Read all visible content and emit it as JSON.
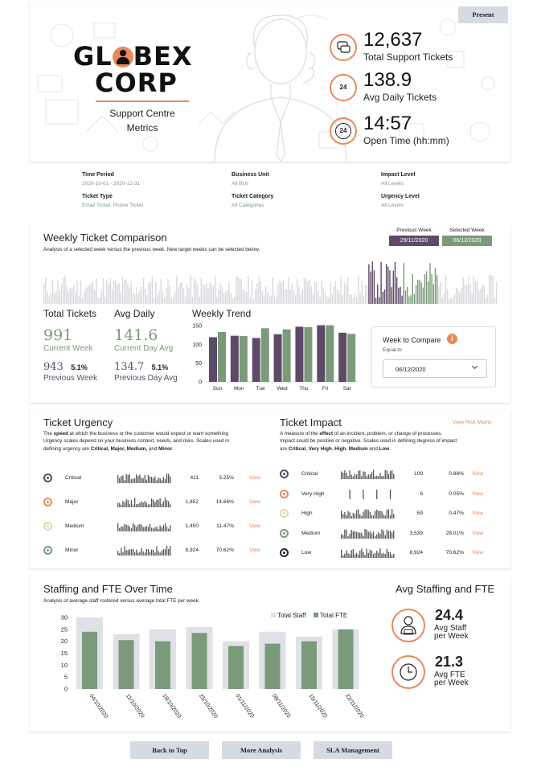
{
  "header": {
    "present_label": "Present",
    "logo_line1": "GL",
    "logo_line1b": "BEX",
    "logo_line2": "CORP",
    "subtitle_line1": "Support Centre",
    "subtitle_line2": "Metrics"
  },
  "kpis": [
    {
      "value": "12,637",
      "label": "Total Support Tickets",
      "icon": "chat-bubbles-icon"
    },
    {
      "value": "138.9",
      "label": "Avg Daily Tickets",
      "icon": "phone-24-icon"
    },
    {
      "value": "14:57",
      "label": "Open Time (hh:mm)",
      "icon": "clock-24-icon"
    }
  ],
  "filters": {
    "time_period": {
      "label": "Time Period",
      "value": "2020-10-01 - 2020-12-31"
    },
    "business_unit": {
      "label": "Business Unit",
      "value": "All BUs"
    },
    "impact_level": {
      "label": "Impact Level",
      "value": "All Levels"
    },
    "ticket_type": {
      "label": "Ticket Type",
      "value": "Email Ticket, Phone Ticket"
    },
    "ticket_category": {
      "label": "Ticket Category",
      "value": "All Categories"
    },
    "urgency_level": {
      "label": "Urgency Level",
      "value": "All Levels"
    }
  },
  "weekly": {
    "title": "Weekly Ticket Comparison",
    "description": "Analysis of a selected week versus the previous week. New target weeks can be selected below.",
    "previous_week_label": "Previous Week",
    "previous_week_value": "29/11/2020",
    "selected_week_label": "Selected Week",
    "selected_week_value": "06/12/2020",
    "total_tickets_title": "Total Tickets",
    "current_week_value": "991",
    "current_week_label": "Current Week",
    "previous_week_count": "943",
    "previous_week_pct": "5.1%",
    "previous_week_caption": "Previous Week",
    "avg_daily_title": "Avg Daily",
    "current_day_avg_value": "141.6",
    "current_day_avg_label": "Current Day Avg",
    "previous_day_avg_value": "134.7",
    "previous_day_avg_pct": "5.1%",
    "previous_day_avg_label": "Previous Day Avg",
    "trend_title": "Weekly Trend",
    "compare_title": "Week to Compare",
    "compare_equal_label": "Equal to",
    "compare_value": "06/12/2020"
  },
  "colors": {
    "purple": "#5e4a68",
    "green": "#7a9a7a",
    "orange": "#e8895a",
    "light_grey": "#e0e1e6"
  },
  "urgency": {
    "title": "Ticket Urgency",
    "desc_1": "The ",
    "desc_bold": "speed",
    "desc_2": " at which the business or the customer would expect or want something",
    "desc_line2": "Urgency scales depend on your business context, needs, and risks. Scales used in",
    "desc_line3a": "defining urgency are ",
    "desc_line3b": "Critical, Major, Medium,",
    "desc_line3c": " and ",
    "desc_line3d": "Minor",
    "desc_line3e": ".",
    "rows": [
      {
        "name": "Critical",
        "count": "411",
        "pct": "3.25%",
        "action": "View",
        "color": "#5e4a68"
      },
      {
        "name": "Major",
        "count": "1,852",
        "pct": "14.66%",
        "action": "View",
        "color": "#e8895a"
      },
      {
        "name": "Medium",
        "count": "1,450",
        "pct": "11.47%",
        "action": "View",
        "color": "#cfe3a8"
      },
      {
        "name": "Minor",
        "count": "8,924",
        "pct": "70.62%",
        "action": "View",
        "color": "#7a9a7a"
      }
    ]
  },
  "impact": {
    "title": "Ticket Impact",
    "link": "View Risk Matrix",
    "desc_1": "A measure of the ",
    "desc_bold": "effect",
    "desc_2": " of an incident, problem, or change of processes.",
    "desc_line2": "Impact could be positive or negative. Scales used in defining degress of impact",
    "desc_line3a": "are ",
    "desc_line3b": "Critical",
    "desc_line3c": ", ",
    "desc_line3d": "Very High",
    "desc_line3e": ", ",
    "desc_line3f": "High",
    "desc_line3g": ", ",
    "desc_line3h": "Medium",
    "desc_line3i": " and ",
    "desc_line3j": "Low",
    "desc_line3k": ".",
    "rows": [
      {
        "name": "Critical",
        "count": "109",
        "pct": "0.86%",
        "action": "View",
        "color": "#5e4a68"
      },
      {
        "name": "Very High",
        "count": "6",
        "pct": "0.05%",
        "action": "View",
        "color": "#e8895a"
      },
      {
        "name": "High",
        "count": "59",
        "pct": "0.47%",
        "action": "View",
        "color": "#cfe3a8"
      },
      {
        "name": "Medium",
        "count": "3,539",
        "pct": "28.01%",
        "action": "View",
        "color": "#7a9a7a"
      },
      {
        "name": "Low",
        "count": "8,924",
        "pct": "70.62%",
        "action": "View",
        "color": "#1f2a36"
      }
    ]
  },
  "staffing": {
    "title": "Staffing and FTE Over Time",
    "description": "Analysis of average staff rostered versus average total FTE per week.",
    "avg_title": "Avg Staffing and FTE",
    "avg_staff_value": "24.4",
    "avg_staff_label_1": "Avg Staff",
    "avg_staff_label_2": "per Week",
    "avg_fte_value": "21.3",
    "avg_fte_label_1": "Avg FTE",
    "avg_fte_label_2": "per Week"
  },
  "chart_data": [
    {
      "type": "bar",
      "name_hint": "weekly-trend",
      "title": "Weekly Trend",
      "categories": [
        "Sun",
        "Mon",
        "Tue",
        "Wed",
        "Thu",
        "Fri",
        "Sat"
      ],
      "series": [
        {
          "name": "Previous Week",
          "color": "#5e4a68",
          "values": [
            119,
            123,
            117,
            127,
            147,
            151,
            131
          ]
        },
        {
          "name": "Selected Week",
          "color": "#7a9a7a",
          "values": [
            133,
            122,
            143,
            140,
            146,
            151,
            128
          ]
        }
      ],
      "ylim": [
        0,
        150
      ],
      "yticks": [
        0,
        50,
        100,
        150
      ]
    },
    {
      "type": "bar",
      "name_hint": "staffing",
      "title": "",
      "categories": [
        "04/10/2020",
        "11/10/2020",
        "18/10/2020",
        "25/10/2020",
        "01/11/2020",
        "08/11/2020",
        "15/11/2020",
        "22/11/2020"
      ],
      "series": [
        {
          "name": "Total Staff",
          "color": "#e0e1e6",
          "values": [
            30,
            23,
            25,
            26,
            20,
            24,
            22,
            25
          ]
        },
        {
          "name": "Total FTE",
          "color": "#7a9a7a",
          "values": [
            24,
            20.5,
            20,
            23.5,
            18,
            19,
            20,
            25
          ]
        }
      ],
      "ylim": [
        0,
        30
      ],
      "yticks": [
        0,
        5,
        10,
        15,
        20,
        25,
        30
      ],
      "legend": "top-right"
    }
  ],
  "nav": {
    "back_to_top": "Back to Top",
    "more_analysis": "More Analysis",
    "sla_management": "SLA Management"
  }
}
